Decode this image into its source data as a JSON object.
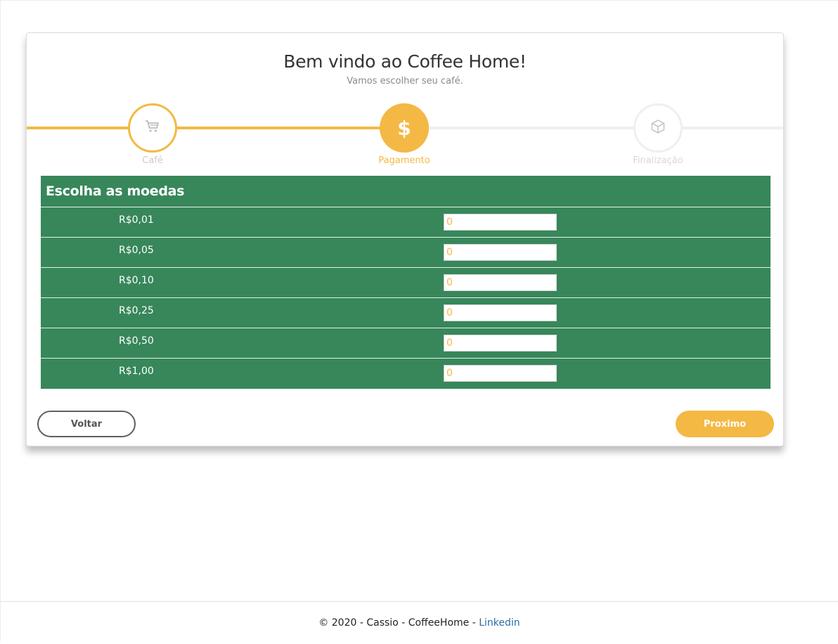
{
  "header": {
    "title": "Bem vindo ao Coffee Home!",
    "subtitle": "Vamos escolher seu café."
  },
  "steps": [
    {
      "label": "Café",
      "icon": "cart-icon",
      "state": "done"
    },
    {
      "label": "Pagamento",
      "icon": "dollar-icon",
      "symbol": "$",
      "state": "active"
    },
    {
      "label": "Finalização",
      "icon": "box-icon",
      "state": "pending"
    }
  ],
  "coins": {
    "title": "Escolha as moedas",
    "rows": [
      {
        "label": "R$0,01",
        "value": "0"
      },
      {
        "label": "R$0,05",
        "value": "0"
      },
      {
        "label": "R$0,10",
        "value": "0"
      },
      {
        "label": "R$0,25",
        "value": "0"
      },
      {
        "label": "R$0,50",
        "value": "0"
      },
      {
        "label": "R$1,00",
        "value": "0"
      }
    ]
  },
  "buttons": {
    "back": "Voltar",
    "next": "Proximo"
  },
  "footer": {
    "text": "© 2020 - Cassio - CoffeeHome - ",
    "link": "Linkedin"
  },
  "colors": {
    "accent": "#f3b944",
    "panel": "#37875a",
    "inactive": "#efefef"
  }
}
